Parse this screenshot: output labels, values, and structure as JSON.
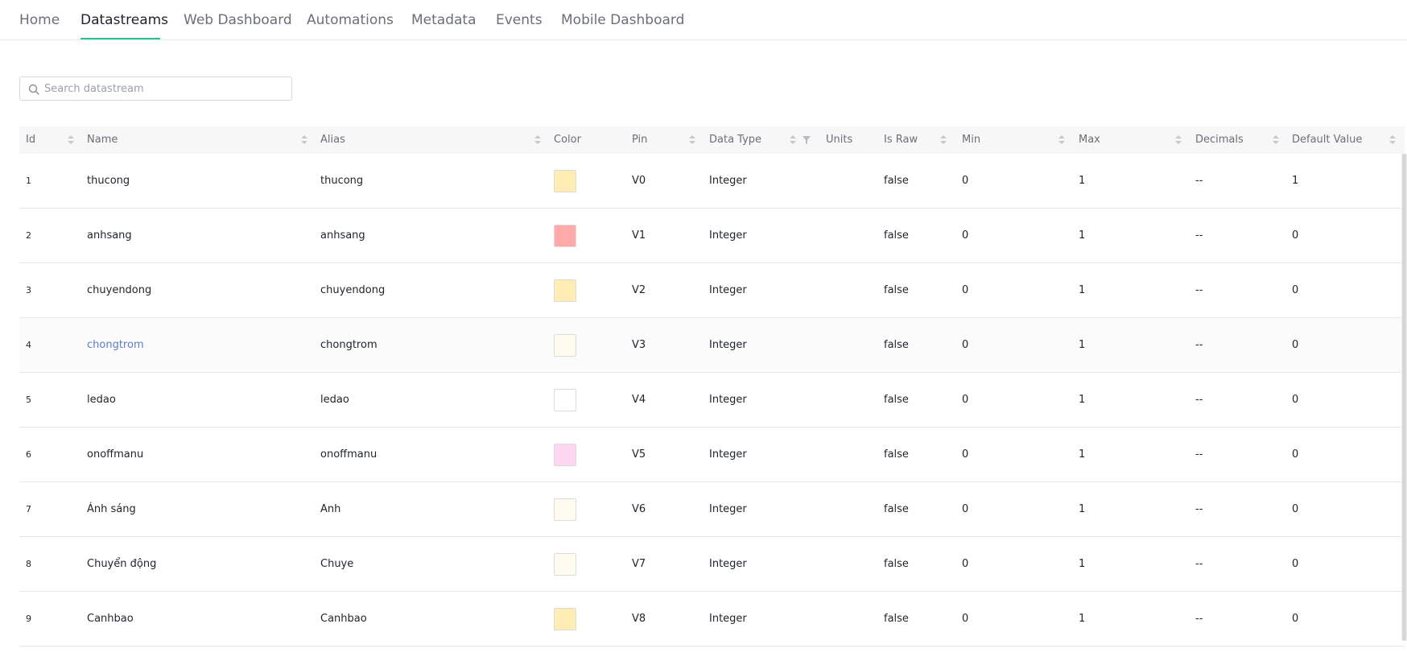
{
  "tabs": [
    {
      "label": "Home",
      "active": false
    },
    {
      "label": "Datastreams",
      "active": true
    },
    {
      "label": "Web Dashboard",
      "active": false
    },
    {
      "label": "Automations",
      "active": false
    },
    {
      "label": "Metadata",
      "active": false
    },
    {
      "label": "Events",
      "active": false
    },
    {
      "label": "Mobile Dashboard",
      "active": false
    }
  ],
  "accent_color": "#23c48e",
  "search": {
    "placeholder": "Search datastream",
    "value": "",
    "icon": "search-icon"
  },
  "table": {
    "columns": [
      {
        "key": "id",
        "label": "Id",
        "sortable": true
      },
      {
        "key": "name",
        "label": "Name",
        "sortable": true
      },
      {
        "key": "alias",
        "label": "Alias",
        "sortable": true
      },
      {
        "key": "color",
        "label": "Color",
        "sortable": false
      },
      {
        "key": "pin",
        "label": "Pin",
        "sortable": true
      },
      {
        "key": "data_type",
        "label": "Data Type",
        "sortable": true,
        "filter": true
      },
      {
        "key": "units",
        "label": "Units",
        "sortable": false
      },
      {
        "key": "is_raw",
        "label": "Is Raw",
        "sortable": true
      },
      {
        "key": "min",
        "label": "Min",
        "sortable": true
      },
      {
        "key": "max",
        "label": "Max",
        "sortable": true
      },
      {
        "key": "decimals",
        "label": "Decimals",
        "sortable": true
      },
      {
        "key": "default_value",
        "label": "Default Value",
        "sortable": true
      }
    ],
    "rows": [
      {
        "id": "1",
        "name": "thucong",
        "alias": "thucong",
        "color": "#FFEDB3",
        "pin": "V0",
        "data_type": "Integer",
        "units": "",
        "is_raw": "false",
        "min": "0",
        "max": "1",
        "decimals": "--",
        "default_value": "1"
      },
      {
        "id": "2",
        "name": "anhsang",
        "alias": "anhsang",
        "color": "#FFA9A9",
        "pin": "V1",
        "data_type": "Integer",
        "units": "",
        "is_raw": "false",
        "min": "0",
        "max": "1",
        "decimals": "--",
        "default_value": "0"
      },
      {
        "id": "3",
        "name": "chuyendong",
        "alias": "chuyendong",
        "color": "#FFEDB3",
        "pin": "V2",
        "data_type": "Integer",
        "units": "",
        "is_raw": "false",
        "min": "0",
        "max": "1",
        "decimals": "--",
        "default_value": "0"
      },
      {
        "id": "4",
        "name": "chongtrom",
        "alias": "chongtrom",
        "color": "#FFFBEE",
        "pin": "V3",
        "data_type": "Integer",
        "units": "",
        "is_raw": "false",
        "min": "0",
        "max": "1",
        "decimals": "--",
        "default_value": "0",
        "hovered": true
      },
      {
        "id": "5",
        "name": "ledao",
        "alias": "ledao",
        "color": "#FFFFFF",
        "pin": "V4",
        "data_type": "Integer",
        "units": "",
        "is_raw": "false",
        "min": "0",
        "max": "1",
        "decimals": "--",
        "default_value": "0"
      },
      {
        "id": "6",
        "name": "onoffmanu",
        "alias": "onoffmanu",
        "color": "#FFD6F2",
        "pin": "V5",
        "data_type": "Integer",
        "units": "",
        "is_raw": "false",
        "min": "0",
        "max": "1",
        "decimals": "--",
        "default_value": "0"
      },
      {
        "id": "7",
        "name": "Ánh sáng",
        "alias": "Anh",
        "color": "#FFFBEE",
        "pin": "V6",
        "data_type": "Integer",
        "units": "",
        "is_raw": "false",
        "min": "0",
        "max": "1",
        "decimals": "--",
        "default_value": "0"
      },
      {
        "id": "8",
        "name": "Chuyển động",
        "alias": "Chuye",
        "color": "#FFFBEE",
        "pin": "V7",
        "data_type": "Integer",
        "units": "",
        "is_raw": "false",
        "min": "0",
        "max": "1",
        "decimals": "--",
        "default_value": "0"
      },
      {
        "id": "9",
        "name": "Canhbao",
        "alias": "Canhbao",
        "color": "#FFEDB3",
        "pin": "V8",
        "data_type": "Integer",
        "units": "",
        "is_raw": "false",
        "min": "0",
        "max": "1",
        "decimals": "--",
        "default_value": "0"
      }
    ]
  }
}
